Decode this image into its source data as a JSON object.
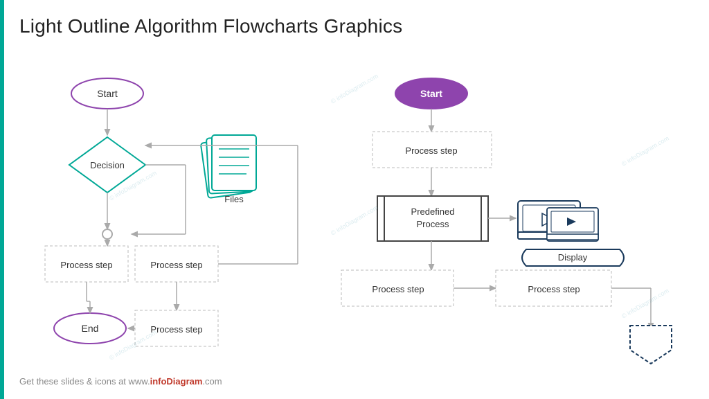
{
  "title": "Light Outline Algorithm Flowcharts Graphics",
  "footer": "Get these slides  & icons at www.infoDiagram.com",
  "footer_brand": "infoDiagram",
  "accent_color": "#00a896",
  "colors": {
    "teal": "#00a896",
    "purple": "#8e44ad",
    "orange": "#e67e22",
    "navy": "#1a3a5c",
    "gray_arrow": "#aaa",
    "process_border": "#ccc",
    "predefined_border": "#444"
  },
  "left_chart": {
    "nodes": [
      {
        "id": "start",
        "label": "Start",
        "type": "oval"
      },
      {
        "id": "decision",
        "label": "Decision",
        "type": "diamond"
      },
      {
        "id": "files",
        "label": "Files",
        "type": "document"
      },
      {
        "id": "proc1",
        "label": "Process step",
        "type": "process"
      },
      {
        "id": "proc2",
        "label": "Process step",
        "type": "process"
      },
      {
        "id": "proc3",
        "label": "Process step",
        "type": "process"
      },
      {
        "id": "end",
        "label": "End",
        "type": "oval"
      }
    ]
  },
  "right_chart": {
    "nodes": [
      {
        "id": "start2",
        "label": "Start",
        "type": "oval"
      },
      {
        "id": "proc4",
        "label": "Process step",
        "type": "process"
      },
      {
        "id": "predef",
        "label": "Predefined\nProcess",
        "type": "predefined"
      },
      {
        "id": "display",
        "label": "Display",
        "type": "display"
      },
      {
        "id": "proc5",
        "label": "Process step",
        "type": "process"
      },
      {
        "id": "proc6",
        "label": "Process step",
        "type": "process"
      },
      {
        "id": "pentagon",
        "label": "",
        "type": "pentagon"
      }
    ]
  },
  "watermarks": [
    "© infoDiagram.com",
    "© infoDiagram.com",
    "© infoDiagram.com"
  ]
}
